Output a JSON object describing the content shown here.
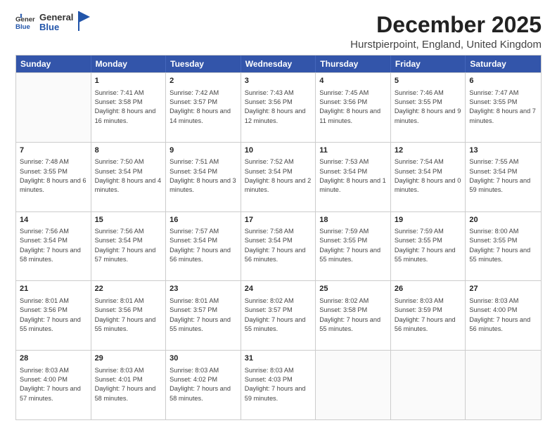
{
  "logo": {
    "general": "General",
    "blue": "Blue"
  },
  "header": {
    "month": "December 2025",
    "location": "Hurstpierpoint, England, United Kingdom"
  },
  "days": [
    "Sunday",
    "Monday",
    "Tuesday",
    "Wednesday",
    "Thursday",
    "Friday",
    "Saturday"
  ],
  "weeks": [
    [
      {
        "day": "",
        "sunrise": "",
        "sunset": "",
        "daylight": ""
      },
      {
        "day": "1",
        "sunrise": "Sunrise: 7:41 AM",
        "sunset": "Sunset: 3:58 PM",
        "daylight": "Daylight: 8 hours and 16 minutes."
      },
      {
        "day": "2",
        "sunrise": "Sunrise: 7:42 AM",
        "sunset": "Sunset: 3:57 PM",
        "daylight": "Daylight: 8 hours and 14 minutes."
      },
      {
        "day": "3",
        "sunrise": "Sunrise: 7:43 AM",
        "sunset": "Sunset: 3:56 PM",
        "daylight": "Daylight: 8 hours and 12 minutes."
      },
      {
        "day": "4",
        "sunrise": "Sunrise: 7:45 AM",
        "sunset": "Sunset: 3:56 PM",
        "daylight": "Daylight: 8 hours and 11 minutes."
      },
      {
        "day": "5",
        "sunrise": "Sunrise: 7:46 AM",
        "sunset": "Sunset: 3:55 PM",
        "daylight": "Daylight: 8 hours and 9 minutes."
      },
      {
        "day": "6",
        "sunrise": "Sunrise: 7:47 AM",
        "sunset": "Sunset: 3:55 PM",
        "daylight": "Daylight: 8 hours and 7 minutes."
      }
    ],
    [
      {
        "day": "7",
        "sunrise": "Sunrise: 7:48 AM",
        "sunset": "Sunset: 3:55 PM",
        "daylight": "Daylight: 8 hours and 6 minutes."
      },
      {
        "day": "8",
        "sunrise": "Sunrise: 7:50 AM",
        "sunset": "Sunset: 3:54 PM",
        "daylight": "Daylight: 8 hours and 4 minutes."
      },
      {
        "day": "9",
        "sunrise": "Sunrise: 7:51 AM",
        "sunset": "Sunset: 3:54 PM",
        "daylight": "Daylight: 8 hours and 3 minutes."
      },
      {
        "day": "10",
        "sunrise": "Sunrise: 7:52 AM",
        "sunset": "Sunset: 3:54 PM",
        "daylight": "Daylight: 8 hours and 2 minutes."
      },
      {
        "day": "11",
        "sunrise": "Sunrise: 7:53 AM",
        "sunset": "Sunset: 3:54 PM",
        "daylight": "Daylight: 8 hours and 1 minute."
      },
      {
        "day": "12",
        "sunrise": "Sunrise: 7:54 AM",
        "sunset": "Sunset: 3:54 PM",
        "daylight": "Daylight: 8 hours and 0 minutes."
      },
      {
        "day": "13",
        "sunrise": "Sunrise: 7:55 AM",
        "sunset": "Sunset: 3:54 PM",
        "daylight": "Daylight: 7 hours and 59 minutes."
      }
    ],
    [
      {
        "day": "14",
        "sunrise": "Sunrise: 7:56 AM",
        "sunset": "Sunset: 3:54 PM",
        "daylight": "Daylight: 7 hours and 58 minutes."
      },
      {
        "day": "15",
        "sunrise": "Sunrise: 7:56 AM",
        "sunset": "Sunset: 3:54 PM",
        "daylight": "Daylight: 7 hours and 57 minutes."
      },
      {
        "day": "16",
        "sunrise": "Sunrise: 7:57 AM",
        "sunset": "Sunset: 3:54 PM",
        "daylight": "Daylight: 7 hours and 56 minutes."
      },
      {
        "day": "17",
        "sunrise": "Sunrise: 7:58 AM",
        "sunset": "Sunset: 3:54 PM",
        "daylight": "Daylight: 7 hours and 56 minutes."
      },
      {
        "day": "18",
        "sunrise": "Sunrise: 7:59 AM",
        "sunset": "Sunset: 3:55 PM",
        "daylight": "Daylight: 7 hours and 55 minutes."
      },
      {
        "day": "19",
        "sunrise": "Sunrise: 7:59 AM",
        "sunset": "Sunset: 3:55 PM",
        "daylight": "Daylight: 7 hours and 55 minutes."
      },
      {
        "day": "20",
        "sunrise": "Sunrise: 8:00 AM",
        "sunset": "Sunset: 3:55 PM",
        "daylight": "Daylight: 7 hours and 55 minutes."
      }
    ],
    [
      {
        "day": "21",
        "sunrise": "Sunrise: 8:01 AM",
        "sunset": "Sunset: 3:56 PM",
        "daylight": "Daylight: 7 hours and 55 minutes."
      },
      {
        "day": "22",
        "sunrise": "Sunrise: 8:01 AM",
        "sunset": "Sunset: 3:56 PM",
        "daylight": "Daylight: 7 hours and 55 minutes."
      },
      {
        "day": "23",
        "sunrise": "Sunrise: 8:01 AM",
        "sunset": "Sunset: 3:57 PM",
        "daylight": "Daylight: 7 hours and 55 minutes."
      },
      {
        "day": "24",
        "sunrise": "Sunrise: 8:02 AM",
        "sunset": "Sunset: 3:57 PM",
        "daylight": "Daylight: 7 hours and 55 minutes."
      },
      {
        "day": "25",
        "sunrise": "Sunrise: 8:02 AM",
        "sunset": "Sunset: 3:58 PM",
        "daylight": "Daylight: 7 hours and 55 minutes."
      },
      {
        "day": "26",
        "sunrise": "Sunrise: 8:03 AM",
        "sunset": "Sunset: 3:59 PM",
        "daylight": "Daylight: 7 hours and 56 minutes."
      },
      {
        "day": "27",
        "sunrise": "Sunrise: 8:03 AM",
        "sunset": "Sunset: 4:00 PM",
        "daylight": "Daylight: 7 hours and 56 minutes."
      }
    ],
    [
      {
        "day": "28",
        "sunrise": "Sunrise: 8:03 AM",
        "sunset": "Sunset: 4:00 PM",
        "daylight": "Daylight: 7 hours and 57 minutes."
      },
      {
        "day": "29",
        "sunrise": "Sunrise: 8:03 AM",
        "sunset": "Sunset: 4:01 PM",
        "daylight": "Daylight: 7 hours and 58 minutes."
      },
      {
        "day": "30",
        "sunrise": "Sunrise: 8:03 AM",
        "sunset": "Sunset: 4:02 PM",
        "daylight": "Daylight: 7 hours and 58 minutes."
      },
      {
        "day": "31",
        "sunrise": "Sunrise: 8:03 AM",
        "sunset": "Sunset: 4:03 PM",
        "daylight": "Daylight: 7 hours and 59 minutes."
      },
      {
        "day": "",
        "sunrise": "",
        "sunset": "",
        "daylight": ""
      },
      {
        "day": "",
        "sunrise": "",
        "sunset": "",
        "daylight": ""
      },
      {
        "day": "",
        "sunrise": "",
        "sunset": "",
        "daylight": ""
      }
    ]
  ]
}
